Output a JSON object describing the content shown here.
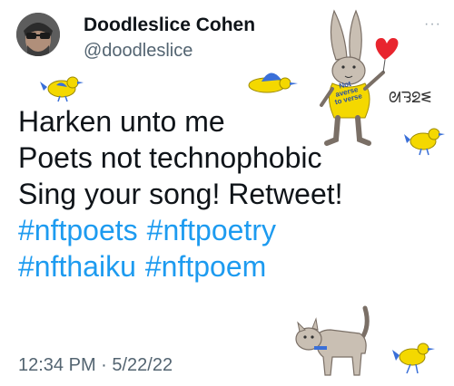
{
  "author": {
    "display_name": "Doodleslice Cohen",
    "handle": "@doodleslice"
  },
  "more_menu": "···",
  "tweet": {
    "lines": [
      "Harken unto me",
      "Poets not technophobic",
      "Sing your song! Retweet!"
    ],
    "hashtags": [
      [
        "#nftpoets",
        "#nftpoetry"
      ],
      [
        "#nfthaiku",
        "#nftpoem"
      ]
    ]
  },
  "timestamp": "12:34 PM · 5/22/22",
  "doodles": {
    "shirt_text": [
      "Not",
      "averse",
      "to verse"
    ],
    "signature": "ᘛᘌᘖᓬ",
    "colors": {
      "yellow": "#f4d800",
      "blue": "#3a6fd8",
      "bunny": "#c9bfb3",
      "heart": "#e8252e"
    }
  }
}
